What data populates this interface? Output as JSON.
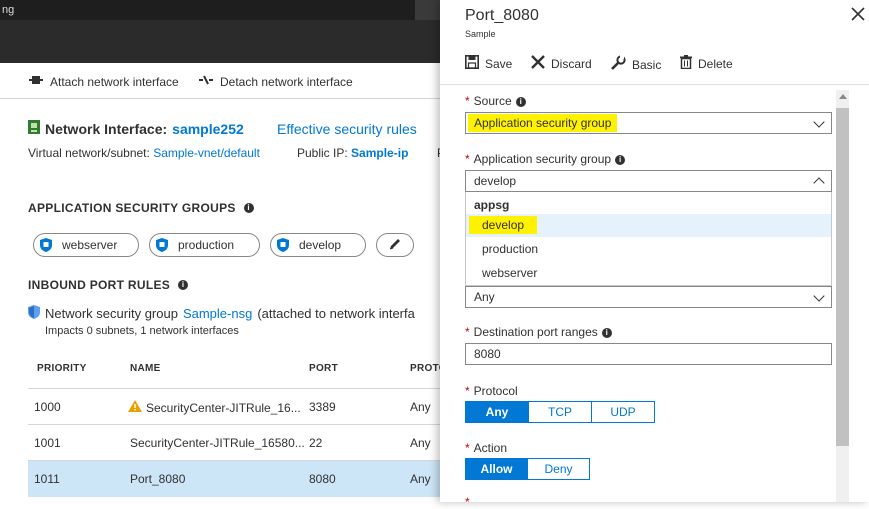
{
  "topbar": {
    "fragment": "ng"
  },
  "toolbar": {
    "attach_label": "Attach network interface",
    "detach_label": "Detach network interface"
  },
  "nic": {
    "label": "Network Interface:",
    "name": "sample252",
    "effective_rules_link": "Effective security rules",
    "vnet_label": "Virtual network/subnet:",
    "vnet_value": "Sample-vnet/default",
    "public_ip_label": "Public IP:",
    "public_ip_value": "Sample-ip",
    "cut_char": "P"
  },
  "asg": {
    "heading": "APPLICATION SECURITY GROUPS",
    "items": [
      "webserver",
      "production",
      "develop"
    ]
  },
  "inbound": {
    "heading": "INBOUND PORT RULES",
    "nsg_prefix": "Network security group",
    "nsg_name": "Sample-nsg",
    "nsg_suffix": "(attached to network interfa",
    "impacts": "Impacts 0 subnets, 1 network interfaces",
    "columns": [
      "PRIORITY",
      "NAME",
      "PORT",
      "PROTO"
    ],
    "rows": [
      {
        "priority": "1000",
        "name": "SecurityCenter-JITRule_16...",
        "port": "3389",
        "proto": "Any"
      },
      {
        "priority": "1001",
        "name": "SecurityCenter-JITRule_16580...",
        "port": "22",
        "proto": "Any"
      },
      {
        "priority": "1011",
        "name": "Port_8080",
        "port": "8080",
        "proto": "Any"
      }
    ]
  },
  "panel": {
    "title": "Port_8080",
    "subtitle": "Sample",
    "actions": {
      "save": "Save",
      "discard": "Discard",
      "basic": "Basic",
      "delete": "Delete"
    },
    "source_label": "Source",
    "source_value": "Application security group",
    "asg_label": "Application security group",
    "asg_value": "develop",
    "asg_options_group": "appsg",
    "asg_options": [
      "develop",
      "production",
      "webserver"
    ],
    "any_value": "Any",
    "dest_ports_label": "Destination port ranges",
    "dest_ports_value": "8080",
    "protocol_label": "Protocol",
    "protocol_options": [
      "Any",
      "TCP",
      "UDP"
    ],
    "action_label": "Action",
    "action_options": [
      "Allow",
      "Deny"
    ]
  },
  "colors": {
    "accent": "#0078d4",
    "highlight": "#fff200",
    "selected_row": "#cde6f7",
    "warning": "#e8a200"
  }
}
